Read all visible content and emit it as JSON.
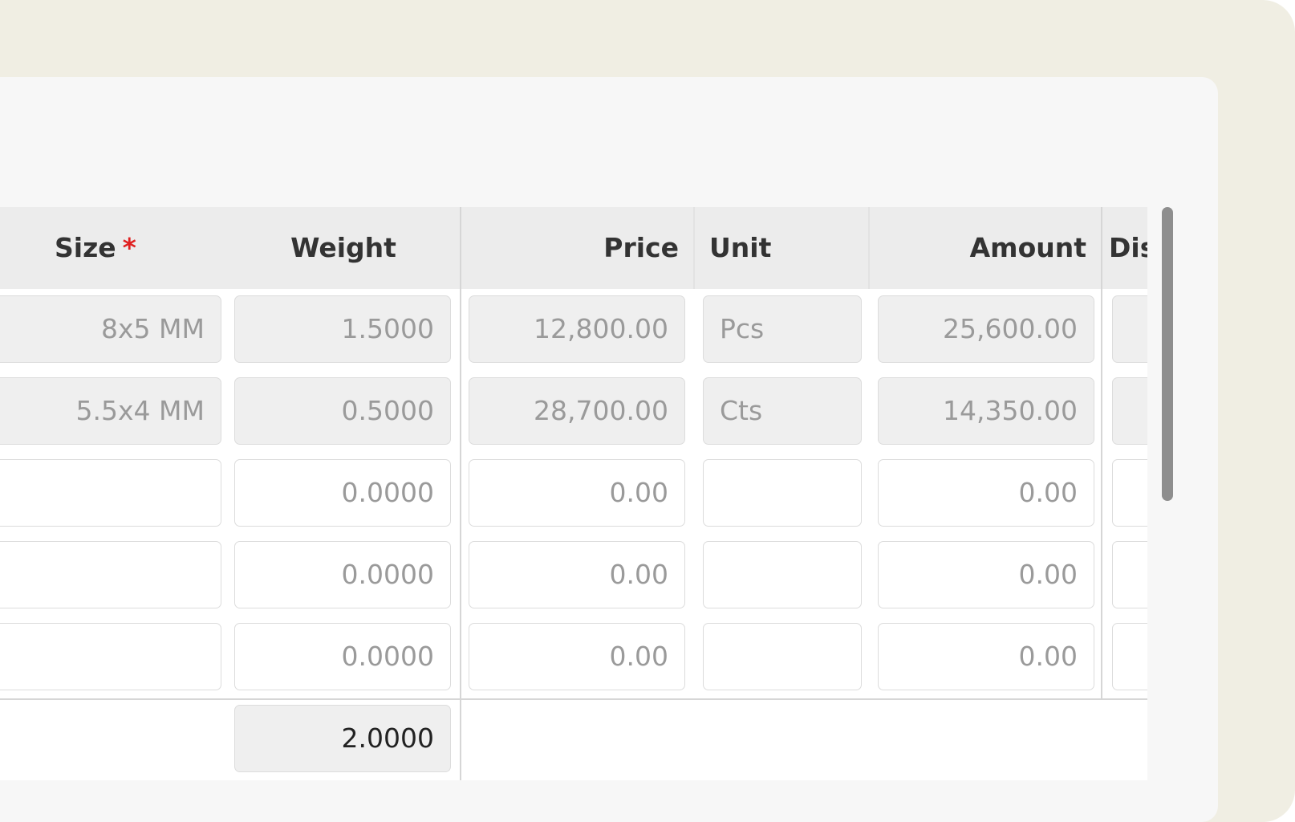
{
  "columns": {
    "size": "Size",
    "size_required_mark": "*",
    "weight": "Weight",
    "price": "Price",
    "unit": "Unit",
    "amount": "Amount",
    "discount_partial": "Dis"
  },
  "rows": [
    {
      "size": "8x5 MM",
      "weight": "1.5000",
      "price": "12,800.00",
      "unit": "Pcs",
      "amount": "25,600.00"
    },
    {
      "size": "5.5x4 MM",
      "weight": "0.5000",
      "price": "28,700.00",
      "unit": "Cts",
      "amount": "14,350.00"
    },
    {
      "size": "",
      "weight": "0.0000",
      "price": "0.00",
      "unit": "",
      "amount": "0.00"
    },
    {
      "size": "",
      "weight": "0.0000",
      "price": "0.00",
      "unit": "",
      "amount": "0.00"
    },
    {
      "size": "",
      "weight": "0.0000",
      "price": "0.00",
      "unit": "",
      "amount": "0.00"
    }
  ],
  "totals": {
    "weight": "2.0000"
  }
}
